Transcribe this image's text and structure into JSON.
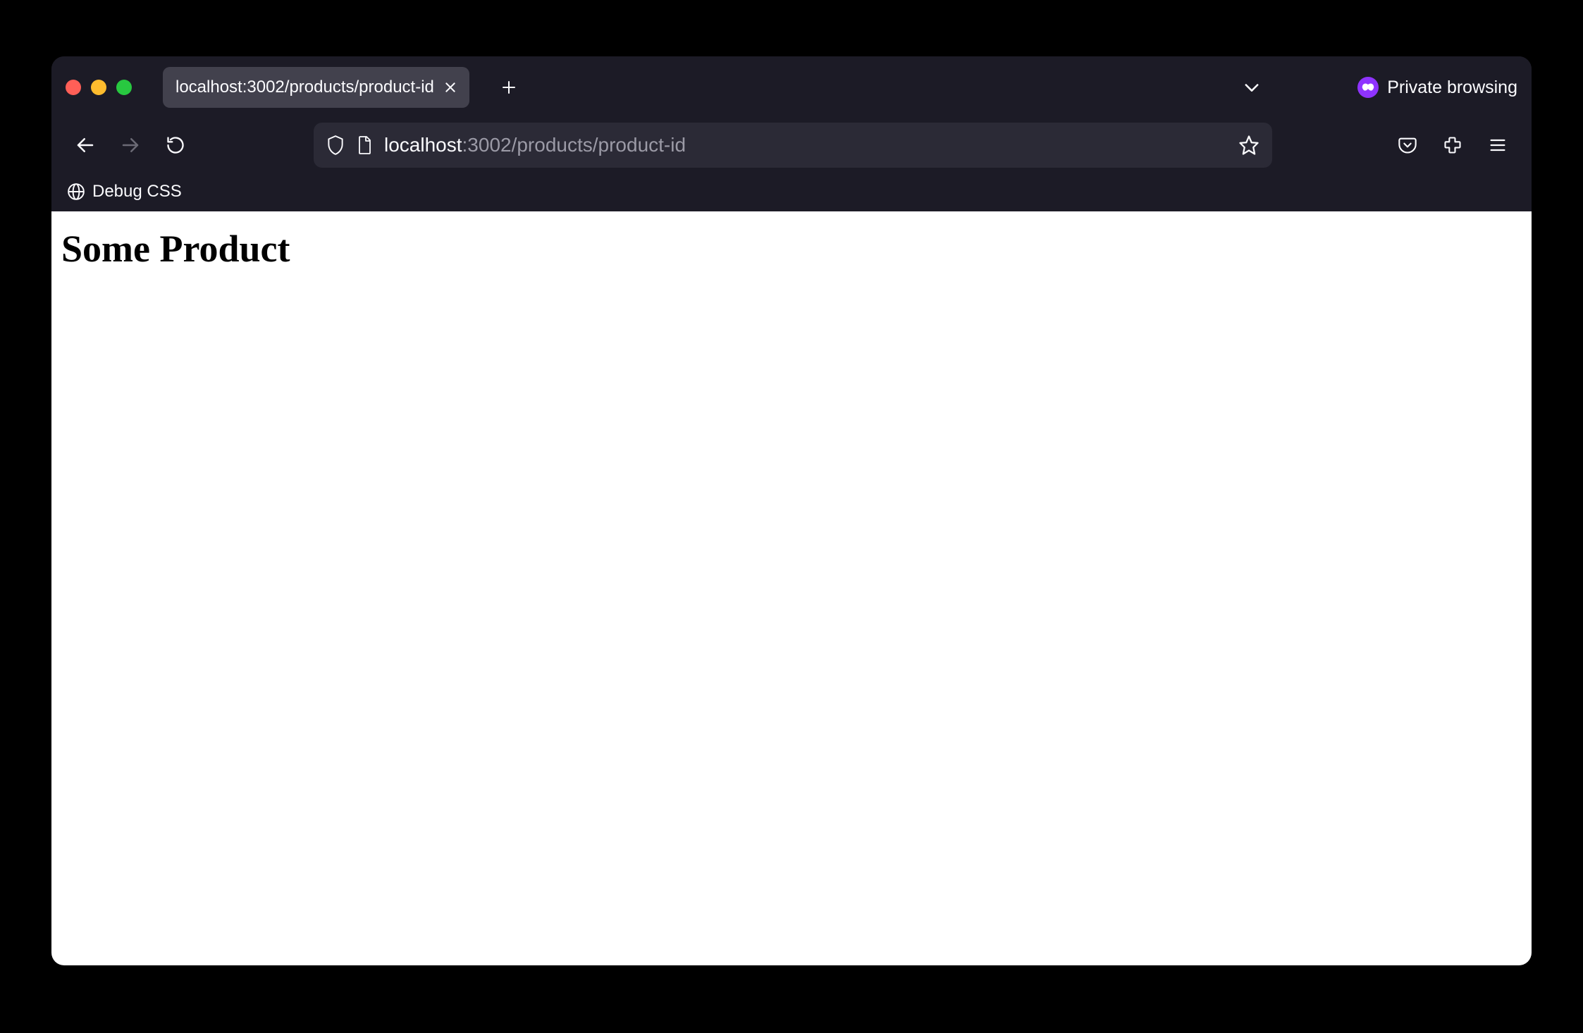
{
  "tabBar": {
    "tab": {
      "title": "localhost:3002/products/product-id"
    },
    "private": {
      "label": "Private browsing"
    }
  },
  "navBar": {
    "url": {
      "host": "localhost",
      "rest": ":3002/products/product-id"
    }
  },
  "bookmarksBar": {
    "items": [
      {
        "label": "Debug CSS"
      }
    ]
  },
  "page": {
    "heading": "Some Product"
  }
}
